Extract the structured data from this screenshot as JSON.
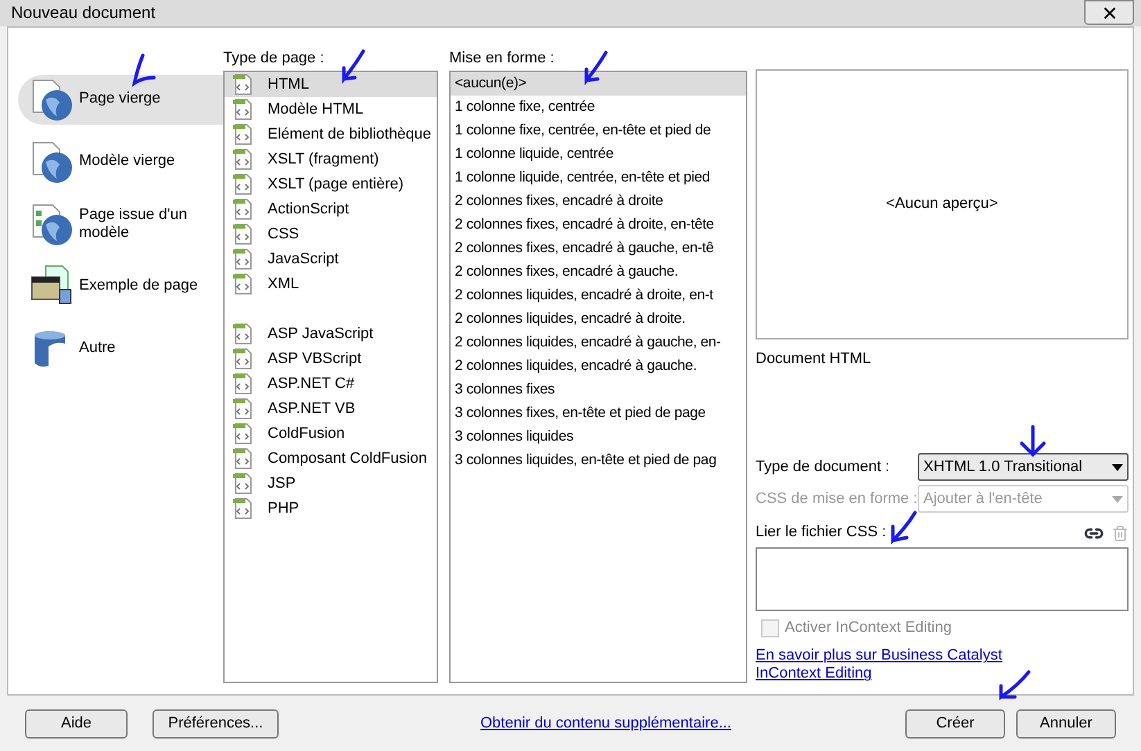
{
  "window": {
    "title": "Nouveau document"
  },
  "categories": [
    {
      "label": "Page vierge",
      "kind": "blank-page",
      "selected": true
    },
    {
      "label": "Modèle vierge",
      "kind": "blank-template",
      "selected": false
    },
    {
      "label": "Page issue d'un modèle",
      "kind": "from-template",
      "selected": false
    },
    {
      "label": "Exemple de page",
      "kind": "sample",
      "selected": false
    },
    {
      "label": "Autre",
      "kind": "other",
      "selected": false
    }
  ],
  "page_type": {
    "label": "Type de page :",
    "groups": [
      [
        {
          "label": "HTML",
          "selected": true
        },
        {
          "label": "Modèle HTML",
          "selected": false
        },
        {
          "label": "Elément de bibliothèque",
          "selected": false
        },
        {
          "label": "XSLT (fragment)",
          "selected": false
        },
        {
          "label": "XSLT (page entière)",
          "selected": false
        },
        {
          "label": "ActionScript",
          "selected": false
        },
        {
          "label": "CSS",
          "selected": false
        },
        {
          "label": "JavaScript",
          "selected": false
        },
        {
          "label": "XML",
          "selected": false
        }
      ],
      [
        {
          "label": "ASP JavaScript",
          "selected": false
        },
        {
          "label": "ASP VBScript",
          "selected": false
        },
        {
          "label": "ASP.NET C#",
          "selected": false
        },
        {
          "label": "ASP.NET VB",
          "selected": false
        },
        {
          "label": "ColdFusion",
          "selected": false
        },
        {
          "label": "Composant ColdFusion",
          "selected": false
        },
        {
          "label": "JSP",
          "selected": false
        },
        {
          "label": "PHP",
          "selected": false
        }
      ]
    ]
  },
  "layout": {
    "label": "Mise en forme :",
    "items": [
      {
        "label": "<aucun(e)>",
        "selected": true
      },
      {
        "label": "1 colonne fixe, centrée",
        "selected": false
      },
      {
        "label": "1 colonne fixe, centrée, en-tête et pied de",
        "selected": false
      },
      {
        "label": "1 colonne liquide, centrée",
        "selected": false
      },
      {
        "label": "1 colonne liquide, centrée, en-tête et pied",
        "selected": false
      },
      {
        "label": "2 colonnes fixes, encadré à droite",
        "selected": false
      },
      {
        "label": "2 colonnes fixes, encadré à droite, en-tête",
        "selected": false
      },
      {
        "label": "2 colonnes fixes, encadré à gauche, en-tê",
        "selected": false
      },
      {
        "label": "2 colonnes fixes, encadré à gauche.",
        "selected": false
      },
      {
        "label": "2 colonnes liquides, encadré à droite, en-t",
        "selected": false
      },
      {
        "label": "2 colonnes liquides, encadré à droite.",
        "selected": false
      },
      {
        "label": "2 colonnes liquides, encadré à gauche, en-",
        "selected": false
      },
      {
        "label": "2 colonnes liquides, encadré à gauche.",
        "selected": false
      },
      {
        "label": "3 colonnes fixes",
        "selected": false
      },
      {
        "label": "3 colonnes fixes, en-tête et pied de page",
        "selected": false
      },
      {
        "label": "3 colonnes liquides",
        "selected": false
      },
      {
        "label": "3 colonnes liquides, en-tête et pied de pag",
        "selected": false
      }
    ]
  },
  "preview": {
    "placeholder": "<Aucun aperçu>",
    "description": "Document HTML"
  },
  "doc_type": {
    "label": "Type de document :",
    "value": "XHTML 1.0 Transitional",
    "disabled": false
  },
  "css_layout": {
    "label": "CSS de mise en forme :",
    "value": "Ajouter à l'en-tête",
    "disabled": true
  },
  "link_css": {
    "label": "Lier le fichier CSS :"
  },
  "incontext": {
    "label": "Activer InContext Editing",
    "checked": false,
    "disabled": true
  },
  "info_link": "En savoir plus sur Business Catalyst InContext Editing",
  "footer": {
    "left_buttons": [
      "Aide",
      "Préférences..."
    ],
    "link": "Obtenir du contenu supplémentaire...",
    "right_buttons": [
      "Créer",
      "Annuler"
    ]
  }
}
